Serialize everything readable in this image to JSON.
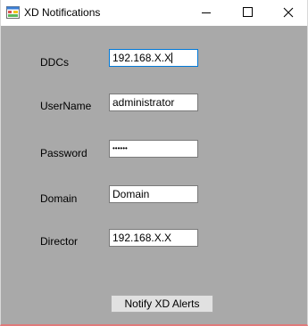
{
  "window": {
    "title": "XD Notifications",
    "icon": "windows-form-icon"
  },
  "caption_buttons": {
    "minimize_icon": "minimize-icon",
    "maximize_icon": "maximize-icon",
    "close_icon": "close-icon"
  },
  "form": {
    "ddcs_label": "DDCs",
    "ddcs_value": "192.168.X.X",
    "username_label": "UserName",
    "username_value": "administrator",
    "password_label": "Password",
    "password_value": "••••••",
    "domain_label": "Domain",
    "domain_value": "Domain",
    "director_label": "Director",
    "director_value": "192.168.X.X"
  },
  "actions": {
    "notify_label": "Notify XD Alerts"
  },
  "colors": {
    "form_background": "#a9a9a9",
    "titlebar_background": "#ffffff",
    "focus_border": "#0078d7"
  }
}
